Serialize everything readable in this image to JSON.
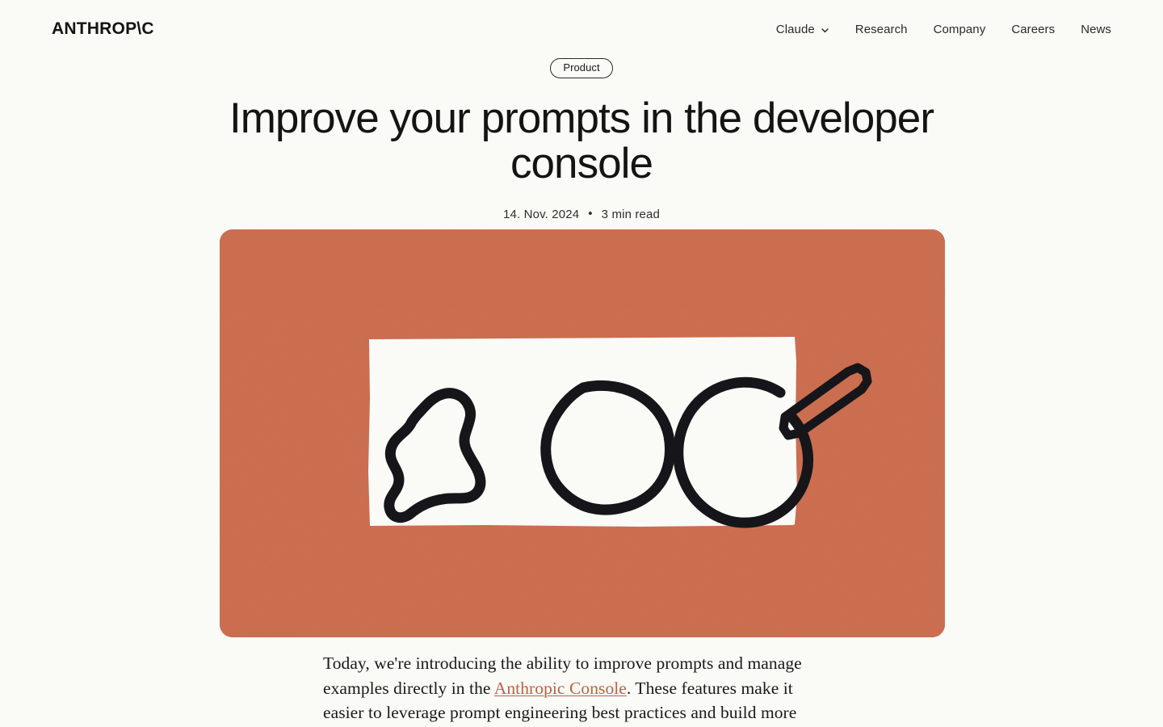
{
  "site": {
    "brand": "ANTHROP\\C"
  },
  "nav": {
    "items": [
      {
        "label": "Claude",
        "icon": "chevron-down-icon",
        "has_dropdown": true
      },
      {
        "label": "Research",
        "icon": "",
        "has_dropdown": false
      },
      {
        "label": "Company",
        "icon": "",
        "has_dropdown": false
      },
      {
        "label": "Careers",
        "icon": "",
        "has_dropdown": false
      },
      {
        "label": "News",
        "icon": "",
        "has_dropdown": false
      }
    ]
  },
  "article": {
    "category_badge": "Product",
    "title": "Improve your prompts in the developer console",
    "date": "14. Nov. 2024",
    "separator": "•",
    "read_time": "3 min read",
    "hero": {
      "alt": "Three hand-drawn shapes progressing from an irregular blob to a smooth circle being drawn by a pencil",
      "background_color": "#CC6B4C",
      "card_color": "#FAFAF7",
      "ink_color": "#16161A"
    },
    "body": {
      "text_before_link": "Today, we're introducing the ability to improve prompts and manage examples directly in the ",
      "link_text": "Anthropic Console",
      "text_after_link": ". These features make it easier to leverage prompt engineering best practices and build more"
    }
  },
  "theme": {
    "page_background": "#FAFAF7",
    "text_color": "#141413",
    "accent": "#CC6B4C",
    "link_color": "#C2603F"
  }
}
